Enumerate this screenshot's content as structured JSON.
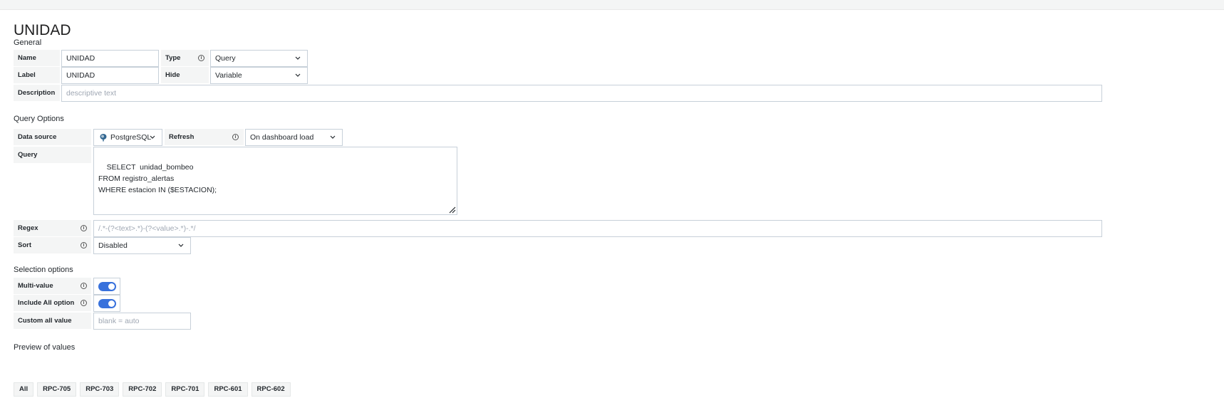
{
  "variable": {
    "title": "UNIDAD",
    "general_section": "General",
    "name_label": "Name",
    "name_value": "UNIDAD",
    "type_label": "Type",
    "type_value": "Query",
    "label_label": "Label",
    "label_value": "UNIDAD",
    "hide_label": "Hide",
    "hide_value": "Variable",
    "description_label": "Description",
    "description_placeholder": "descriptive text"
  },
  "query_options": {
    "section": "Query Options",
    "data_source_label": "Data source",
    "data_source_value": "PostgreSQL",
    "refresh_label": "Refresh",
    "refresh_value": "On dashboard load",
    "query_label": "Query",
    "query_text": "SELECT  unidad_bombeo\nFROM registro_alertas\nWHERE estacion IN ($ESTACION);",
    "regex_label": "Regex",
    "regex_placeholder": "/.*-(?<text>.*)-(?<value>.*)-.*/",
    "sort_label": "Sort",
    "sort_value": "Disabled"
  },
  "selection_options": {
    "section": "Selection options",
    "multi_value_label": "Multi-value",
    "multi_value_enabled": true,
    "include_all_label": "Include All option",
    "include_all_enabled": true,
    "custom_all_label": "Custom all value",
    "custom_all_placeholder": "blank = auto"
  },
  "preview": {
    "section": "Preview of values",
    "values": [
      "All",
      "RPC-705",
      "RPC-703",
      "RPC-702",
      "RPC-701",
      "RPC-601",
      "RPC-602"
    ]
  },
  "icons": {
    "info": "info-icon",
    "chevron": "chevron-down-icon",
    "datasource": "postgresql-icon",
    "resize": "resize-handle-icon"
  },
  "colors": {
    "toggle_on": "#3871dc",
    "label_bg": "#f4f5f5",
    "border": "#c7d0d9"
  }
}
